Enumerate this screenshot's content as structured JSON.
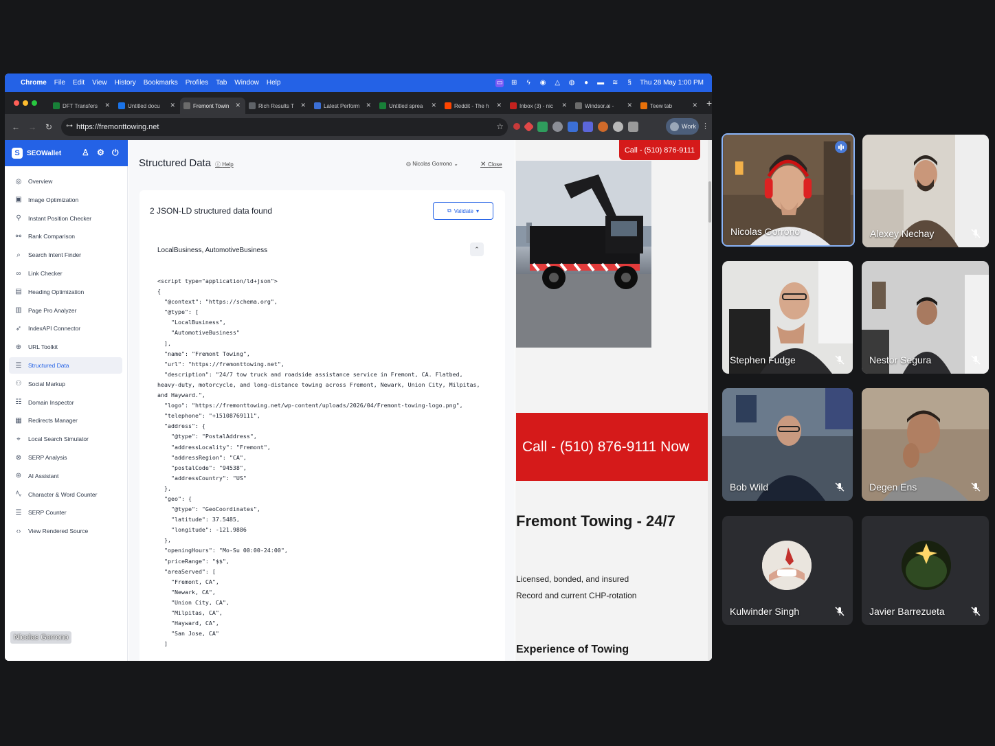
{
  "menubar": {
    "app": "Chrome",
    "items": [
      "File",
      "Edit",
      "View",
      "History",
      "Bookmarks",
      "Profiles",
      "Tab",
      "Window",
      "Help"
    ],
    "clock": "Thu 28 May  1:00 PM"
  },
  "tabs": [
    {
      "label": "DFT Transfers",
      "color": "#188038"
    },
    {
      "label": "Untitled docu",
      "color": "#1a73e8"
    },
    {
      "label": "Fremont Towin",
      "color": "#6b6b6b"
    },
    {
      "label": "Rich Results T",
      "color": "#5f6368"
    },
    {
      "label": "Latest Perform",
      "color": "#3b6fd6"
    },
    {
      "label": "Untitled sprea",
      "color": "#188038"
    },
    {
      "label": "Reddit - The h",
      "color": "#ff4500"
    },
    {
      "label": "Inbox (3) - nic",
      "color": "#c5221f"
    },
    {
      "label": "Windsor.ai -",
      "color": "#6b6b6b"
    },
    {
      "label": "Teew tab",
      "color": "#e8710a"
    }
  ],
  "address": {
    "url": "https://fremonttowing.net"
  },
  "profile_label": "Work",
  "sidebar": {
    "brand": "SEOWallet",
    "items": [
      {
        "label": "Overview",
        "icon": "overview-icon",
        "glyph": "◎"
      },
      {
        "label": "Image Optimization",
        "icon": "image-icon",
        "glyph": "▣"
      },
      {
        "label": "Instant Position Checker",
        "icon": "hierarchy-icon",
        "glyph": "⚲"
      },
      {
        "label": "Rank Comparison",
        "icon": "compare-icon",
        "glyph": "⚯"
      },
      {
        "label": "Search Intent Finder",
        "icon": "search-icon",
        "glyph": "⌕"
      },
      {
        "label": "Link Checker",
        "icon": "link-icon",
        "glyph": "∞"
      },
      {
        "label": "Heading Optimization",
        "icon": "heading-icon",
        "glyph": "▤"
      },
      {
        "label": "Page Pro Analyzer",
        "icon": "page-icon",
        "glyph": "▥"
      },
      {
        "label": "IndexAPI Connector",
        "icon": "rocket-icon",
        "glyph": "➶"
      },
      {
        "label": "URL Toolkit",
        "icon": "globe-icon",
        "glyph": "⊕"
      },
      {
        "label": "Structured Data",
        "icon": "structured-data-icon",
        "glyph": "☰"
      },
      {
        "label": "Social Markup",
        "icon": "social-icon",
        "glyph": "⚇"
      },
      {
        "label": "Domain Inspector",
        "icon": "domain-icon",
        "glyph": "☷"
      },
      {
        "label": "Redirects Manager",
        "icon": "redirect-icon",
        "glyph": "▦"
      },
      {
        "label": "Local Search Simulator",
        "icon": "location-icon",
        "glyph": "⌖"
      },
      {
        "label": "SERP Analysis",
        "icon": "serp-icon",
        "glyph": "⊗"
      },
      {
        "label": "AI Assistant",
        "icon": "ai-icon",
        "glyph": "⊛"
      },
      {
        "label": "Character & Word Counter",
        "icon": "counter-icon",
        "glyph": "ᴬᵥ"
      },
      {
        "label": "SERP Counter",
        "icon": "list-icon",
        "glyph": "☰"
      },
      {
        "label": "View Rendered Source",
        "icon": "code-icon",
        "glyph": "‹›"
      }
    ],
    "active_index": 10
  },
  "name_chip": "Nicolas Gorrono",
  "structured": {
    "title": "Structured Data",
    "help": "Help",
    "user": "Nicolas Gorrono",
    "close": "Close",
    "found": "2 JSON-LD structured data found",
    "validate": "Validate",
    "types": "LocalBusiness, AutomotiveBusiness",
    "code": "<script type=\"application/ld+json\">\n{\n  \"@context\": \"https://schema.org\",\n  \"@type\": [\n    \"LocalBusiness\",\n    \"AutomotiveBusiness\"\n  ],\n  \"name\": \"Fremont Towing\",\n  \"url\": \"https://fremonttowing.net\",\n  \"description\": \"24/7 tow truck and roadside assistance service in Fremont, CA. Flatbed,\nheavy-duty, motorcycle, and long-distance towing across Fremont, Newark, Union City, Milpitas,\nand Hayward.\",\n  \"logo\": \"https://fremonttowing.net/wp-content/uploads/2026/04/Fremont-towing-logo.png\",\n  \"telephone\": \"+15108769111\",\n  \"address\": {\n    \"@type\": \"PostalAddress\",\n    \"addressLocality\": \"Fremont\",\n    \"addressRegion\": \"CA\",\n    \"postalCode\": \"94538\",\n    \"addressCountry\": \"US\"\n  },\n  \"geo\": {\n    \"@type\": \"GeoCoordinates\",\n    \"latitude\": 37.5485,\n    \"longitude\": -121.9886\n  },\n  \"openingHours\": \"Mo-Su 00:00-24:00\",\n  \"priceRange\": \"$$\",\n  \"areaServed\": [\n    \"Fremont, CA\",\n    \"Newark, CA\",\n    \"Union City, CA\",\n    \"Milpitas, CA\",\n    \"Hayward, CA\",\n    \"San Jose, CA\"\n  ]"
  },
  "site": {
    "call_button": "Call - (510) 876-9111",
    "banner": "Call - (510) 876-9111 Now",
    "heading": "Fremont Towing - 24/7",
    "line1": "Licensed, bonded, and insured",
    "line2": "Record and current CHP-rotation",
    "subheading": "Experience of Towing"
  },
  "participants": [
    {
      "name": "Nicolas Gorrono",
      "muted": false,
      "speaking": true
    },
    {
      "name": "Alexey Nechay",
      "muted": true,
      "speaking": false
    },
    {
      "name": "Stephen Fudge",
      "muted": true,
      "speaking": false
    },
    {
      "name": "Nestor Segura",
      "muted": true,
      "speaking": false
    },
    {
      "name": "Bob Wild",
      "muted": true,
      "speaking": false
    },
    {
      "name": "Degen Ens",
      "muted": true,
      "speaking": false
    },
    {
      "name": "Kulwinder Singh",
      "muted": true,
      "speaking": false
    },
    {
      "name": "Javier Barrezueta",
      "muted": true,
      "speaking": false
    }
  ],
  "colors": {
    "accent": "#2462e6",
    "brand_red": "#d51a1a",
    "meet_bg": "#161719"
  }
}
